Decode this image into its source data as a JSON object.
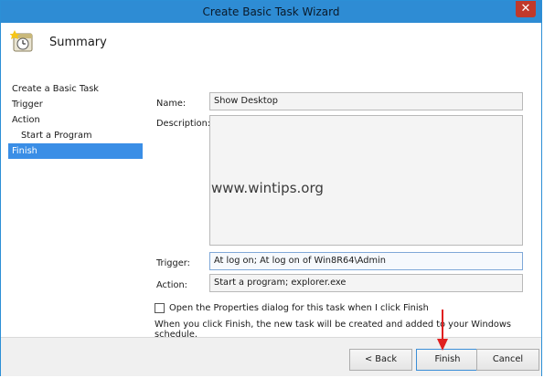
{
  "window": {
    "title": "Create Basic Task Wizard",
    "close_glyph": "✕"
  },
  "header": {
    "title": "Summary",
    "icon": "task-scheduler-icon"
  },
  "sidebar": {
    "items": [
      {
        "label": "Create a Basic Task"
      },
      {
        "label": "Trigger"
      },
      {
        "label": "Action"
      },
      {
        "label": "Start a Program"
      },
      {
        "label": "Finish"
      }
    ],
    "active_index": 4
  },
  "form": {
    "name_label": "Name:",
    "name_value": "Show Desktop",
    "description_label": "Description:",
    "description_value": "",
    "trigger_label": "Trigger:",
    "trigger_value": "At log on; At log on of Win8R64\\Admin",
    "action_label": "Action:",
    "action_value": "Start a program; explorer.exe"
  },
  "watermark": "www.wintips.org",
  "options": {
    "open_properties_label": "Open the Properties dialog for this task when I click Finish",
    "open_properties_checked": false,
    "info_text": "When you click Finish, the new task will be created and added to your Windows schedule."
  },
  "footer": {
    "back_label": "< Back",
    "finish_label": "Finish",
    "cancel_label": "Cancel"
  },
  "colors": {
    "titlebar": "#2e8cd4",
    "selection": "#3a8ee6",
    "annotation_arrow": "#e02020"
  }
}
